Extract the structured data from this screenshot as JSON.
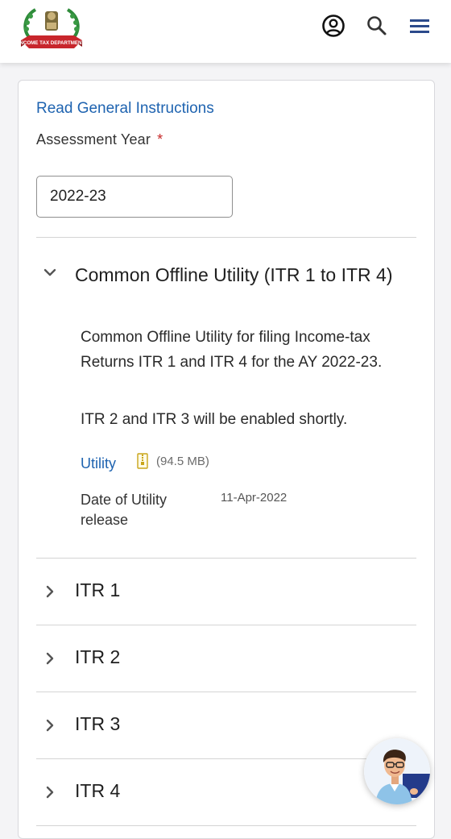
{
  "header": {
    "logo_alt": "Income Tax Department",
    "logo_text": "INCOME TAX DEPARTMENT",
    "icons": [
      "account-icon",
      "search-icon",
      "menu-icon"
    ]
  },
  "instructions_link": "Read General Instructions",
  "assessment_year": {
    "label": "Assessment Year",
    "required_mark": "*",
    "value": "2022-23"
  },
  "accordion": {
    "title": "Common Offline Utility (ITR 1 to ITR 4)",
    "expanded": true,
    "description": "Common Offline Utility for filing Income-tax Returns ITR 1 and ITR 4 for the AY 2022-23.",
    "note": "ITR 2 and ITR 3 will be enabled shortly.",
    "utility_link": "Utility",
    "file_size": "(94.5 MB)",
    "release_label": "Date of Utility release",
    "release_date": "11-Apr-2022"
  },
  "itr_items": [
    {
      "label": "ITR 1"
    },
    {
      "label": "ITR 2"
    },
    {
      "label": "ITR 3"
    },
    {
      "label": "ITR 4"
    }
  ],
  "colors": {
    "link": "#1e63b0",
    "required": "#c62828",
    "menu": "#2b4a8b"
  }
}
